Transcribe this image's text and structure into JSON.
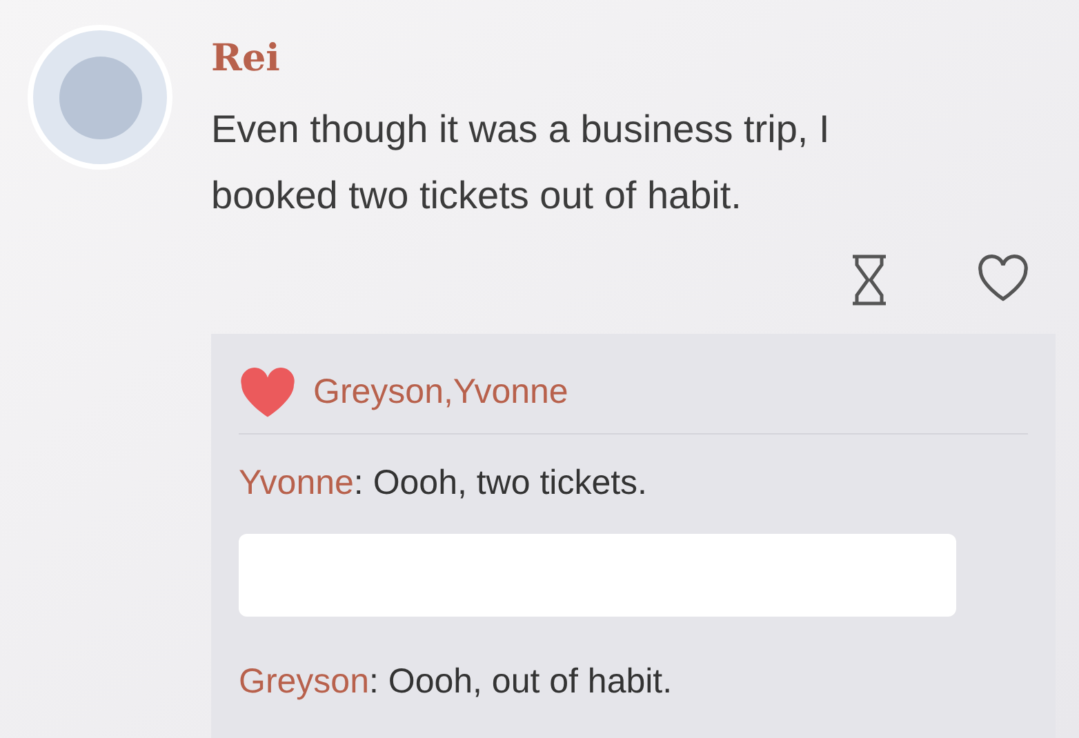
{
  "post": {
    "author": "Rei",
    "text": "Even though it was a business trip, I booked two tickets out of habit.",
    "liked": false
  },
  "likes": {
    "names": "Greyson,Yvonne"
  },
  "comments": [
    {
      "kind": "text",
      "author": "Yvonne",
      "text": ": Oooh, two tickets."
    },
    {
      "kind": "redacted"
    },
    {
      "kind": "text",
      "author": "Greyson",
      "text": ": Oooh, out of habit."
    }
  ]
}
